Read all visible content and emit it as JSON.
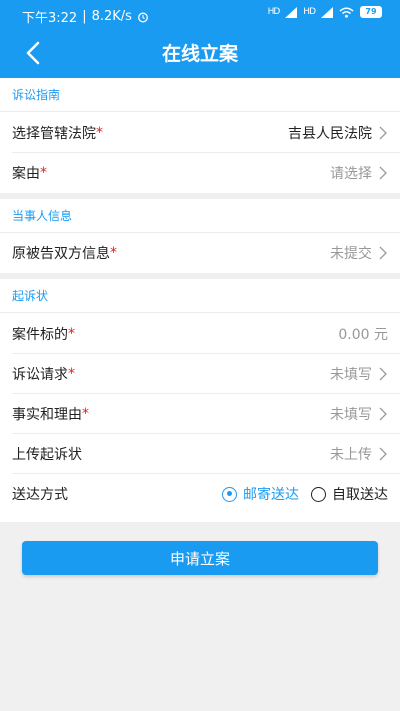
{
  "status": {
    "time": "下午3:22",
    "speed": "8.2K/s",
    "sig1": "HD",
    "sig2": "HD",
    "battery": "79"
  },
  "header": {
    "title": "在线立案"
  },
  "sections": {
    "guide": {
      "label": "诉讼指南"
    },
    "party": {
      "label": "当事人信息"
    },
    "complaint": {
      "label": "起诉状"
    }
  },
  "rows": {
    "court": {
      "label": "选择管辖法院",
      "value": "吉县人民法院"
    },
    "cause": {
      "label": "案由",
      "value": "请选择"
    },
    "parties": {
      "label": "原被告双方信息",
      "value": "未提交"
    },
    "amount": {
      "label": "案件标的",
      "value": "0.00 元"
    },
    "claim": {
      "label": "诉讼请求",
      "value": "未填写"
    },
    "facts": {
      "label": "事实和理由",
      "value": "未填写"
    },
    "upload": {
      "label": "上传起诉状",
      "value": "未上传"
    },
    "delivery": {
      "label": "送达方式",
      "option1": "邮寄送达",
      "option2": "自取送达"
    }
  },
  "required_mark": "*",
  "submit_label": "申请立案",
  "colors": {
    "accent": "#1a9bf2",
    "required": "#e02020"
  }
}
